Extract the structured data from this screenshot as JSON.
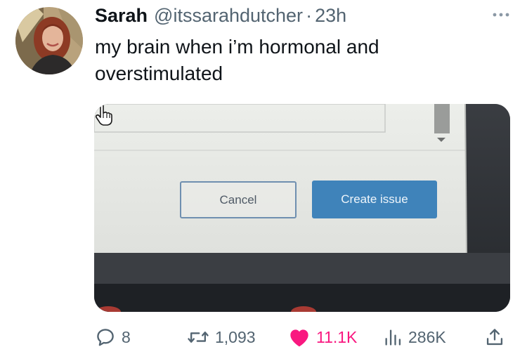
{
  "tweet": {
    "author_name": "Sarah",
    "handle": "@itssarahdutcher",
    "separator": "·",
    "time": "23h",
    "text": "my brain when i’m hormonal and overstimulated"
  },
  "media": {
    "cancel_label": "Cancel",
    "create_label": "Create issue"
  },
  "actions": {
    "replies": "8",
    "retweets": "1,093",
    "likes": "11.1K",
    "views": "286K"
  },
  "icons": {
    "more": "more-horizontal-icon",
    "reply": "reply-icon",
    "retweet": "retweet-icon",
    "like": "heart-icon",
    "views": "views-icon",
    "share": "share-icon",
    "cursor": "hand-pointer-icon"
  },
  "colors": {
    "like": "#f91880",
    "muted": "#536471",
    "create_button": "#3f83ba"
  }
}
